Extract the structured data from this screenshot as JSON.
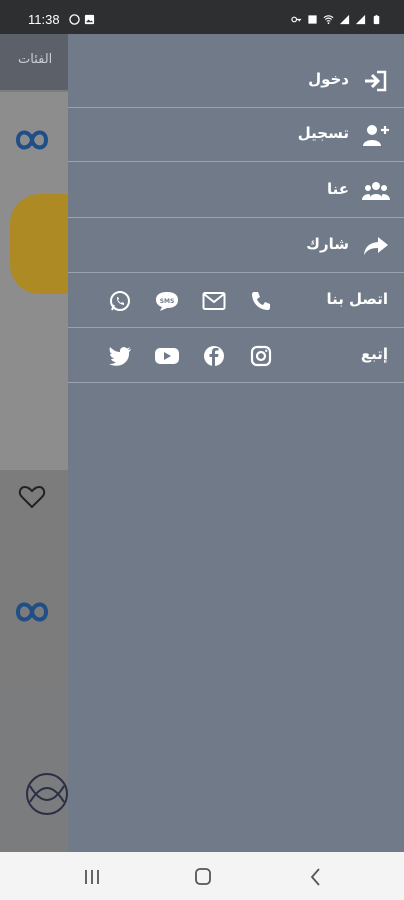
{
  "status_bar": {
    "time": "11:38"
  },
  "background_app": {
    "header_title": "الفئات"
  },
  "drawer": {
    "items": [
      {
        "label": "دخول",
        "icon": "login-icon"
      },
      {
        "label": "تسجيل",
        "icon": "add-user-icon"
      },
      {
        "label": "عنا",
        "icon": "users-icon"
      },
      {
        "label": "شارك",
        "icon": "share-icon"
      }
    ],
    "contact": {
      "label": "اتصل بنا",
      "icons": [
        "phone-icon",
        "email-icon",
        "sms-icon",
        "whatsapp-icon"
      ]
    },
    "follow": {
      "label": "إتبع",
      "icons": [
        "instagram-icon",
        "facebook-icon",
        "youtube-icon",
        "twitter-icon"
      ]
    },
    "colors": {
      "drawer_bg": "#707a89",
      "text": "#ffffff",
      "divider": "#9aa2ae"
    }
  },
  "nav_bar": {
    "buttons": [
      "recent-apps-button",
      "home-button",
      "back-button"
    ]
  }
}
